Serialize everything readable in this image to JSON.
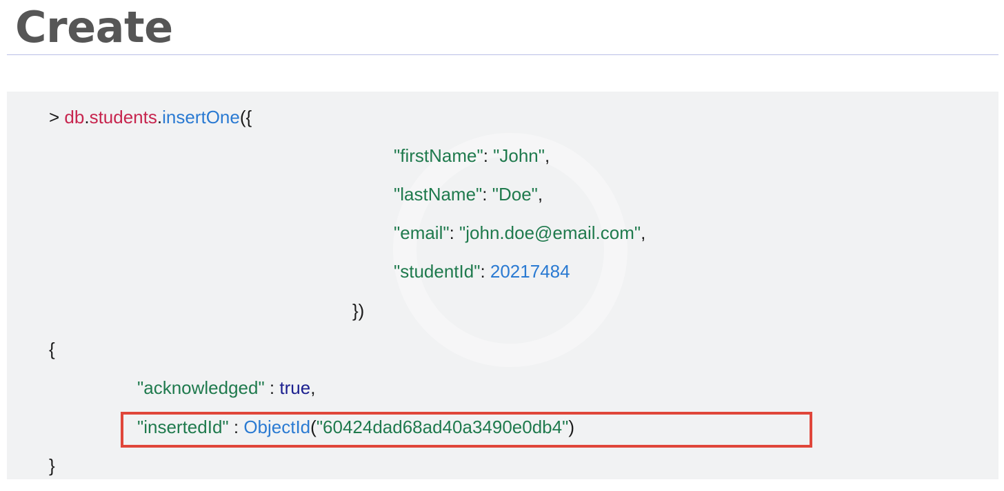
{
  "slide": {
    "title": "Create"
  },
  "code": {
    "prompt": ">",
    "db": "db",
    "dot1": ".",
    "collection": "students",
    "dot2": ".",
    "method": "insertOne",
    "open_call": "({",
    "fields": [
      {
        "key": "\"firstName\"",
        "sep": ": ",
        "value": "\"John\"",
        "trail": ","
      },
      {
        "key": "\"lastName\"",
        "sep": ": ",
        "value": "\"Doe\"",
        "trail": ","
      },
      {
        "key": "\"email\"",
        "sep": ": ",
        "value": "\"john.doe@email.com\"",
        "trail": ","
      },
      {
        "key": "\"studentId\"",
        "sep": ": ",
        "value": "20217484",
        "trail": ""
      }
    ],
    "close_call": "})"
  },
  "result": {
    "open_brace": "{",
    "acknowledged_key": "\"acknowledged\"",
    "acknowledged_sep": " : ",
    "acknowledged_value": "true",
    "acknowledged_trail": ",",
    "inserted_key": "\"insertedId\"",
    "inserted_sep": " : ",
    "objectid_fn": "ObjectId",
    "objectid_open": "(",
    "objectid_value": "\"60424dad68ad40a3490e0db4\"",
    "objectid_close": ")",
    "close_brace": "}"
  },
  "colors": {
    "title": "#565656",
    "rule": "#b9bfe6",
    "panel_bg": "#f1f2f3",
    "db_red": "#c7254e",
    "method_blue": "#2a7ad2",
    "string_green": "#1f7a4d",
    "bool_navy": "#1b1f8f",
    "highlight_red": "#e0463a"
  }
}
